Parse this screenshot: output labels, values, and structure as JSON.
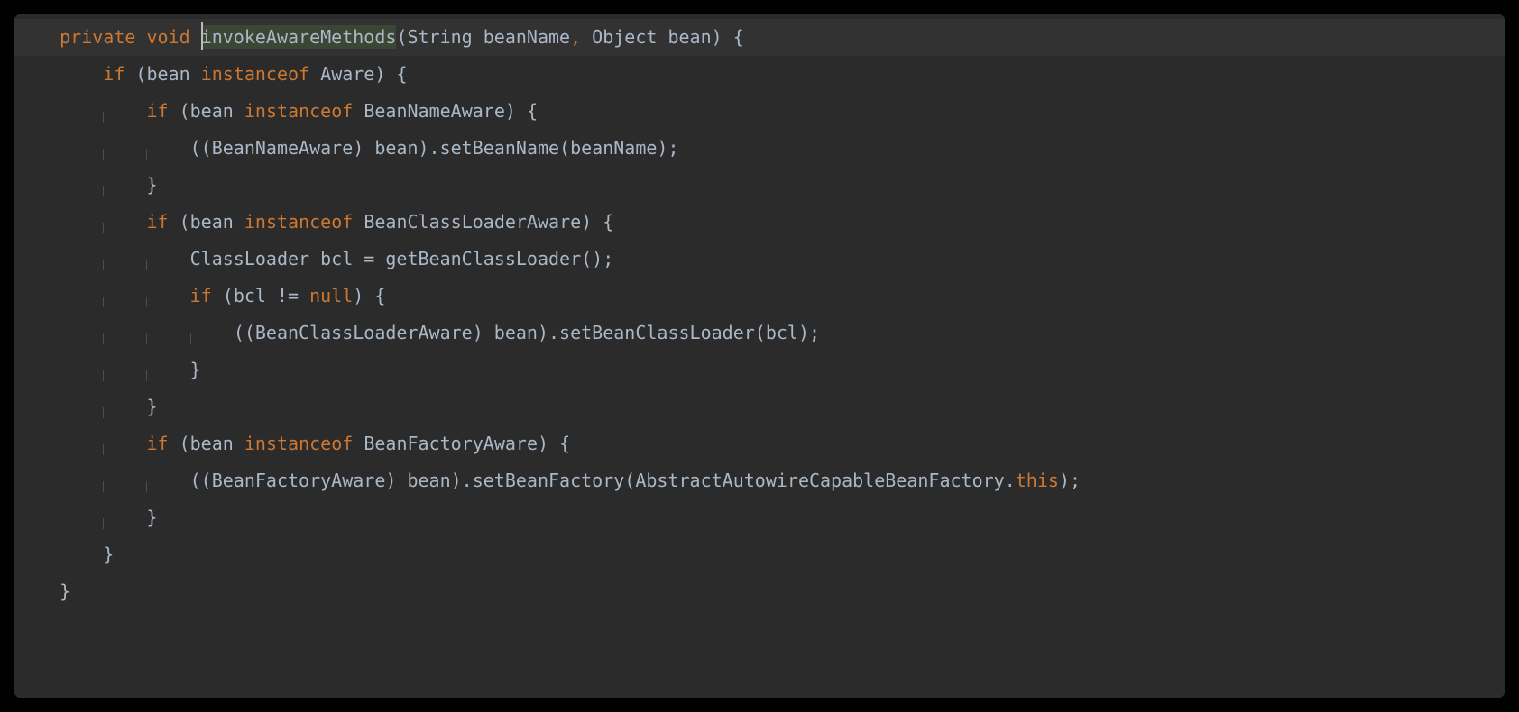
{
  "code": {
    "mod_private": "private",
    "mod_void": "void",
    "method_name": "invokeAwareMethods",
    "sig_open": "(String beanName",
    "sig_comma": ",",
    "sig_rest": " Object bean) {",
    "if_kw": "if",
    "instanceof_kw": "instanceof",
    "null_kw": "null",
    "this_kw": "this",
    "open_paren": " (bean ",
    "aware": "Aware",
    "close_cond": ") {",
    "bean_name_aware": "BeanNameAware",
    "cast_bna": "((BeanNameAware) bean).setBeanName(beanName);",
    "close_brace": "}",
    "bean_cl_aware": "BeanClassLoaderAware",
    "cl_decl": "ClassLoader bcl = getBeanClassLoader();",
    "bcl_cond": " (bcl != ",
    "bcl_cond_end": ") {",
    "cast_bcla": "((BeanClassLoaderAware) bean).setBeanClassLoader(bcl);",
    "bean_factory_aware": "BeanFactoryAware",
    "cast_bfa_pre": "((BeanFactoryAware) bean).setBeanFactory(AbstractAutowireCapableBeanFactory.",
    "cast_bfa_post": ");"
  },
  "colors": {
    "bg": "#2b2b2b",
    "fg": "#a9b7c6",
    "keyword": "#cc7832",
    "highlight_line": "#323232",
    "method_highlight": "rgba(80,110,60,0.35)"
  }
}
